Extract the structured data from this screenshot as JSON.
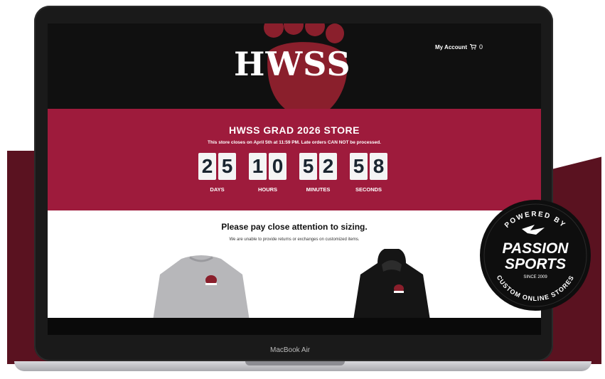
{
  "store": {
    "logo": "HWSS",
    "nav": {
      "account": "My Account",
      "cart_count": "0"
    },
    "banner": {
      "title": "HWSS GRAD 2026 STORE",
      "notice": "This store closes on April 5th at 11:59 PM. Late orders CAN NOT be processed."
    },
    "countdown": [
      {
        "d1": "2",
        "d2": "5",
        "label": "DAYS"
      },
      {
        "d1": "1",
        "d2": "0",
        "label": "HOURS"
      },
      {
        "d1": "5",
        "d2": "2",
        "label": "MINUTES"
      },
      {
        "d1": "5",
        "d2": "8",
        "label": "SECONDS"
      }
    ],
    "content": {
      "heading": "Please pay close attention to sizing.",
      "subtext": "We are unable to provide returns or exchanges on customized items."
    }
  },
  "device": {
    "model": "MacBook Air"
  },
  "badge": {
    "top": "POWERED BY",
    "line1": "PASSION",
    "line2": "SPORTS",
    "since": "SINCE 2009",
    "bottom": "CUSTOM ONLINE STORES"
  },
  "colors": {
    "brand_red": "#9e1b3c",
    "maroon": "#5a1220",
    "header_black": "#101010"
  }
}
